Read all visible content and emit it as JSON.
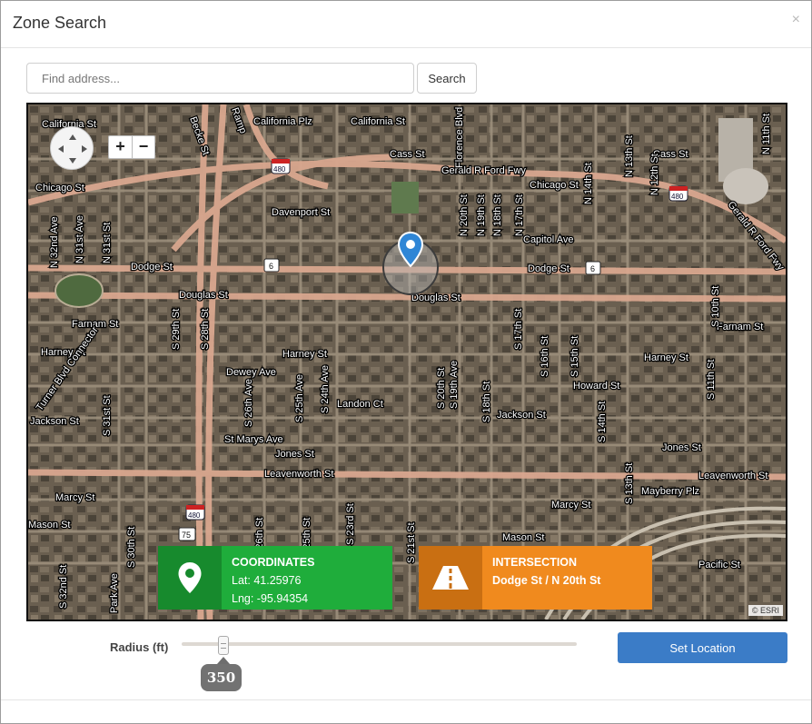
{
  "dialog": {
    "title": "Zone Search",
    "close_icon": "×"
  },
  "search": {
    "placeholder": "Find address...",
    "value": "",
    "button_label": "Search"
  },
  "map": {
    "zoom_in_label": "+",
    "zoom_out_label": "−",
    "attribution": "© ESRI",
    "street_labels": [
      "California St",
      "California Plz",
      "California St",
      "Cass St",
      "Cass St",
      "Gerald R Ford Fwy",
      "Chicago St",
      "Chicago St",
      "Davenport St",
      "Capitol Ave",
      "Dodge St",
      "Dodge St",
      "Douglas St",
      "Douglas St",
      "Farnam St",
      "Farnam St",
      "Harney St",
      "Harney St",
      "Harney St",
      "Dewey Ave",
      "Howard St",
      "Landon Ct",
      "Jackson St",
      "Jackson St",
      "St Marys Ave",
      "Jones St",
      "Jones St",
      "Leavenworth St",
      "Leavenworth St",
      "Marcy St",
      "Marcy St",
      "Mayberry Plz",
      "Mason St",
      "Mason St",
      "Pacific St",
      "Park Ave",
      "Turner Blvd Connector",
      "N 32nd Ave",
      "N 31st Ave",
      "N 31st St",
      "S 29th St",
      "S 28th St",
      "S 26th Ave",
      "S 25th Ave",
      "S 24th Ave",
      "S 20th St",
      "S 19th Ave",
      "S 18th St",
      "S 17th St",
      "S 16th St",
      "S 15th St",
      "S 14th St",
      "S 13th St",
      "S 11th St",
      "S 10th St",
      "N 20th St",
      "N 19th St",
      "N 18th St",
      "N 17th St",
      "N 14th St",
      "N 13th St",
      "N 12th St",
      "N 11th St",
      "S 31st St",
      "S 30th St",
      "S 26th St",
      "S 25th St",
      "S 23rd St",
      "S 21st St",
      "S 32nd St",
      "Gerald R Ford Fwy",
      "Florence Blvd",
      "Becke St",
      "Ramp"
    ],
    "highway_shields": [
      "480",
      "480",
      "480",
      "480",
      "6",
      "6",
      "75"
    ]
  },
  "coordinates_panel": {
    "icon": "map-marker-icon",
    "caption": "COORDINATES",
    "lat": "Lat: 41.25976",
    "lng": "Lng: -95.94354",
    "color": "#1fad3b"
  },
  "intersection_panel": {
    "icon": "road-icon",
    "caption": "INTERSECTION",
    "value": "Dodge St / N 20th St",
    "color": "#f08a1e"
  },
  "radius": {
    "label": "Radius (ft)",
    "value": "350",
    "slider_fraction": 0.1
  },
  "actions": {
    "set_location_label": "Set Location",
    "accent_color": "#3b7cc7"
  }
}
